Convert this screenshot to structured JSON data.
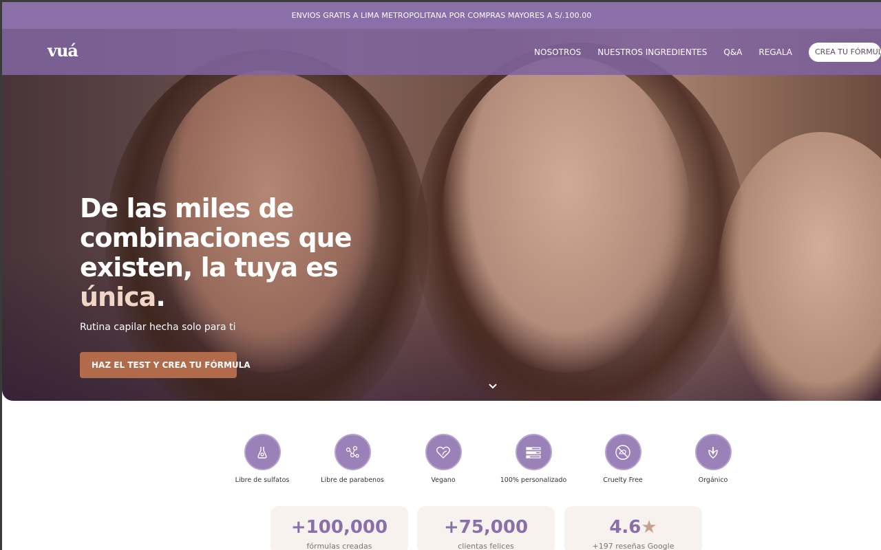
{
  "promo_text": "ENVIOS GRATIS A LIMA METROPOLITANA POR COMPRAS MAYORES A S/.100.00",
  "nav": {
    "logo": "vuá",
    "links": [
      "NOSOTROS",
      "NUESTROS INGREDIENTES",
      "Q&A",
      "REGALA"
    ],
    "cta": "CREA TU FÓRMULA"
  },
  "hero": {
    "headline_main": "De las miles de combinaciones que existen, la tuya es",
    "headline_accent": "única",
    "headline_end": ".",
    "subline": "Rutina capilar hecha solo para ti",
    "cta": "HAZ EL TEST Y CREA TU FÓRMULA",
    "scroll_icon": "chevron-down-icon"
  },
  "features": [
    {
      "label": "Libre de sulfatos",
      "icon": "flask-drop-icon"
    },
    {
      "label": "Libre de parabenos",
      "icon": "molecule-icon"
    },
    {
      "label": "Vegano",
      "icon": "heart-leaf-icon"
    },
    {
      "label": "100% personalizado",
      "icon": "sliders-icon"
    },
    {
      "label": "Cruelty Free",
      "icon": "no-animal-testing-icon"
    },
    {
      "label": "Orgánico",
      "icon": "plant-icon"
    }
  ],
  "stats": [
    {
      "number": "+100,000",
      "label": "fórmulas creadas"
    },
    {
      "number": "+75,000",
      "label": "clientas felices"
    },
    {
      "number": "4.6",
      "label": "+197 reseñas Google"
    }
  ],
  "colors": {
    "brand_purple": "#8a6fa8",
    "cta_brown": "#b16b4a",
    "accent_cream": "#f1d6c6"
  }
}
